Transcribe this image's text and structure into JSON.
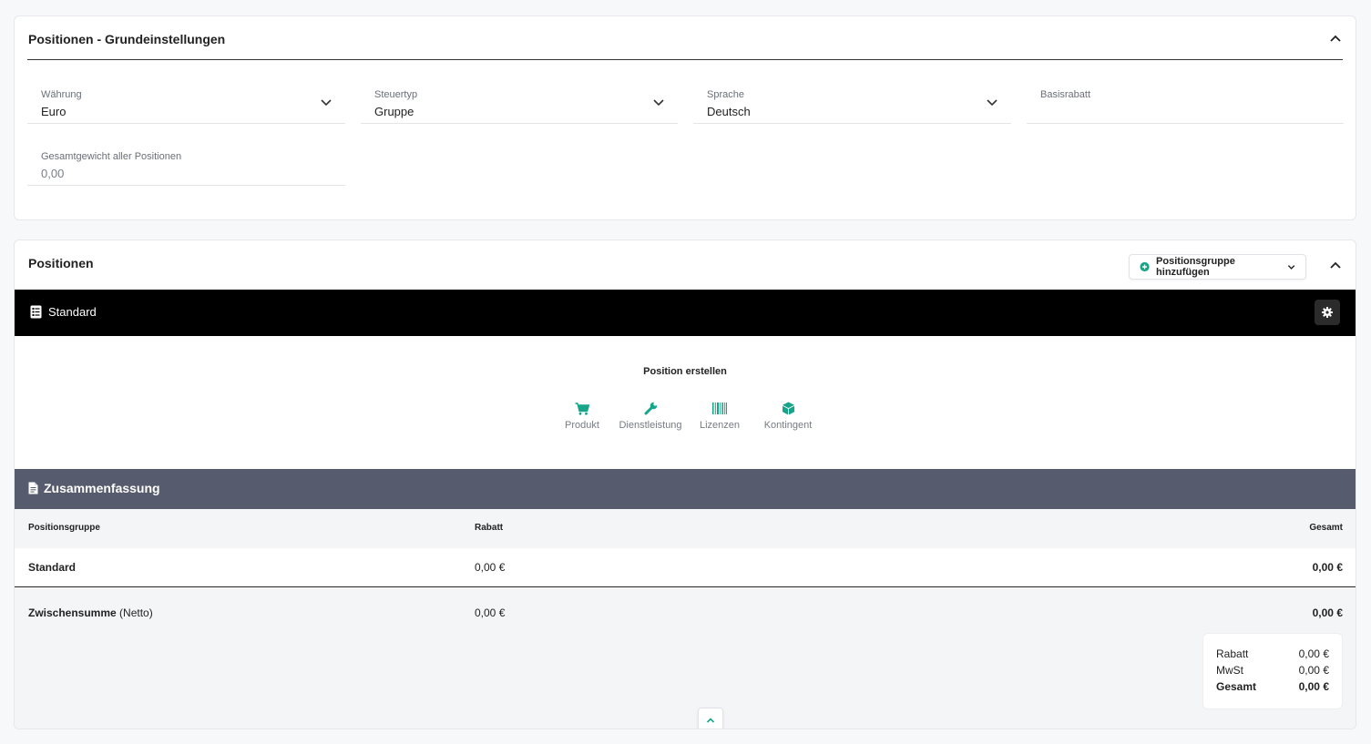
{
  "basic_settings": {
    "title": "Positionen - Grundeinstellungen",
    "fields": {
      "currency": {
        "label": "Währung",
        "value": "Euro"
      },
      "tax_type": {
        "label": "Steuertyp",
        "value": "Gruppe"
      },
      "language": {
        "label": "Sprache",
        "value": "Deutsch"
      },
      "base_discount": {
        "label": "Basisrabatt",
        "value": ""
      },
      "total_weight": {
        "label": "Gesamtgewicht aller Positionen",
        "value": "0,00"
      }
    }
  },
  "positions": {
    "title": "Positionen",
    "add_group_label": "Positionsgruppe hinzufügen",
    "group": {
      "name": "Standard"
    },
    "create": {
      "title": "Position erstellen",
      "items": [
        {
          "label": "Produkt",
          "icon": "cart-icon"
        },
        {
          "label": "Dienstleistung",
          "icon": "wrench-icon"
        },
        {
          "label": "Lizenzen",
          "icon": "barcode-icon"
        },
        {
          "label": "Kontingent",
          "icon": "box-icon"
        }
      ]
    }
  },
  "summary": {
    "title": "Zusammenfassung",
    "headers": {
      "group": "Positionsgruppe",
      "discount": "Rabatt",
      "total": "Gesamt"
    },
    "rows": [
      {
        "group": "Standard",
        "discount": "0,00 €",
        "total": "0,00 €"
      }
    ],
    "subtotal": {
      "label": "Zwischensumme",
      "suffix": "(Netto)",
      "discount": "0,00 €",
      "total": "0,00 €"
    },
    "totals": {
      "discount_label": "Rabatt",
      "discount_value": "0,00 €",
      "vat_label": "MwSt",
      "vat_value": "0,00 €",
      "total_label": "Gesamt",
      "total_value": "0,00 €"
    }
  },
  "colors": {
    "accent": "#17a589",
    "group_bar": "#000000",
    "summary_bar": "#565b6d"
  }
}
